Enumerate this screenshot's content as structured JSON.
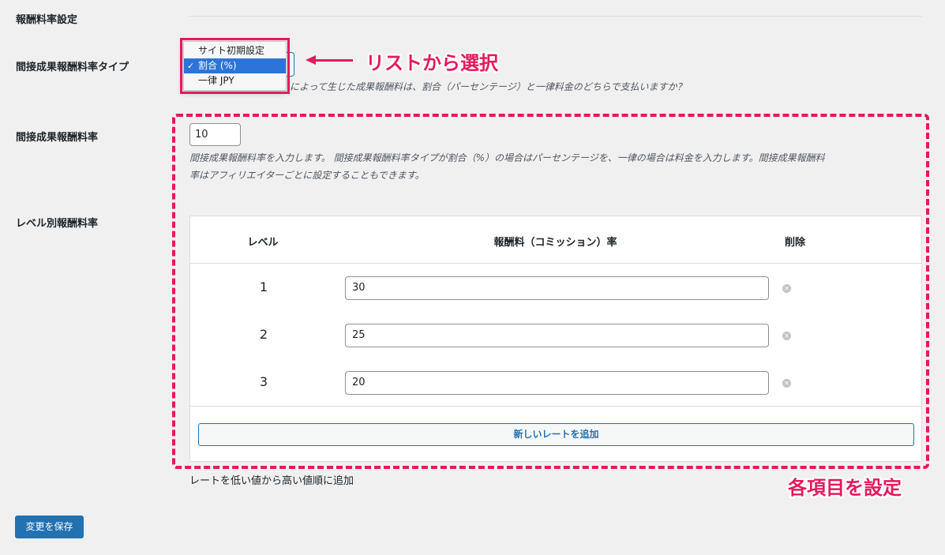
{
  "section": {
    "title": "報酬料率設定"
  },
  "type_row": {
    "label": "間接成果報酬料率タイプ",
    "options": [
      "サイト初期設定",
      "割合 (%)",
      "一律 JPY"
    ],
    "selected": "割合 (%)",
    "description_visible": "によって生じた成果報酬料は、割合（パーセンテージ）と一律料金のどちらで支払いますか？"
  },
  "annotations": {
    "select_from_list": "リストから選択",
    "set_each_item": "各項目を設定",
    "color": "#e6195d"
  },
  "rate_row": {
    "label": "間接成果報酬料率",
    "value": "10",
    "description_line1": "間接成果報酬料率を入力します。 間接成果報酬料率タイプが割合（%）の場合はパーセンテージを、一律の場合は料金を入力します。間接成果報酬料",
    "description_line2": "率はアフィリエイターごとに設定することもできます。"
  },
  "level_row": {
    "label": "レベル別報酬料率",
    "headers": {
      "level": "レベル",
      "rate": "報酬料（コミッション）率",
      "delete": "削除"
    },
    "rows": [
      {
        "level": "1",
        "rate": "30"
      },
      {
        "level": "2",
        "rate": "25"
      },
      {
        "level": "3",
        "rate": "20"
      }
    ],
    "add_button": "新しいレートを追加",
    "hint": "レートを低い値から高い値順に追加"
  },
  "save_button": "変更を保存",
  "colors": {
    "primary": "#2271b1",
    "selected_option": "#2d74d8"
  }
}
